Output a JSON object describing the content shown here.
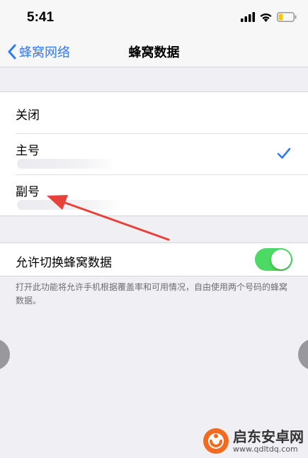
{
  "status_bar": {
    "time": "5:41"
  },
  "nav": {
    "back_label": "蜂窝网络",
    "title": "蜂窝数据"
  },
  "options": [
    {
      "label": "关闭",
      "selected": false
    },
    {
      "label": "主号",
      "selected": true
    },
    {
      "label": "副号",
      "selected": false
    }
  ],
  "switching": {
    "label": "允许切换蜂窝数据",
    "enabled": true,
    "description": "打开此功能将允许手机根据覆盖率和可用情况，自由使用两个号码的蜂窝数据。"
  },
  "watermark": {
    "name": "启东安卓网",
    "url": "www.qdltdq.com"
  },
  "colors": {
    "accent_blue": "#2f7bf6",
    "toggle_green": "#4cd964",
    "arrow_red": "#e8413a",
    "group_background": "#efeff4"
  },
  "icons": {
    "back": "chevron-left-icon",
    "selection": "checkmark-icon",
    "signal": "signal-bars-icon",
    "wifi": "wifi-icon",
    "battery": "battery-icon"
  }
}
